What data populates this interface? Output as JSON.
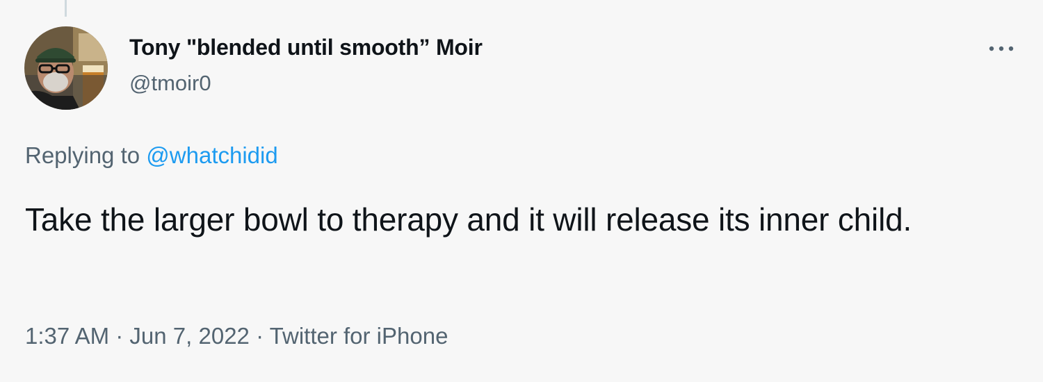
{
  "author": {
    "display_name": "Tony \"blended until smooth” Moir",
    "handle": "@tmoir0"
  },
  "reply": {
    "prefix": "Replying to",
    "mention": "@whatchidid"
  },
  "tweet": {
    "text": "Take the larger bowl to therapy and it will release its inner child.",
    "time": "1:37 AM",
    "separator": "·",
    "date": "Jun 7, 2022",
    "source": "Twitter for iPhone"
  },
  "icons": {
    "more": "more-horizontal-icon"
  },
  "colors": {
    "background": "#f7f7f7",
    "text": "#0f1419",
    "secondary": "#536471",
    "link": "#1d9bf0"
  }
}
